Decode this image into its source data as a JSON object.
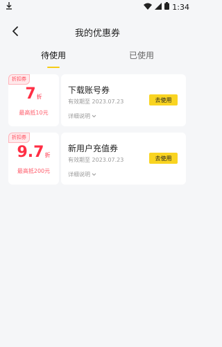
{
  "status_bar": {
    "time": "1:34",
    "icons": [
      "download-icon",
      "wifi-icon",
      "signal-icon",
      "battery-icon"
    ]
  },
  "header": {
    "title": "我的优惠券",
    "back_icon": "chevron-left-icon"
  },
  "tabs": [
    {
      "label": "待使用",
      "active": true
    },
    {
      "label": "已使用",
      "active": false
    }
  ],
  "coupons": [
    {
      "tag": "折扣券",
      "discount_value": "7",
      "discount_unit": "折",
      "max_off": "最高抵10元",
      "title": "下载账号券",
      "expire": "有效期至 2023.07.23",
      "detail_label": "详细说明",
      "use_label": "去使用"
    },
    {
      "tag": "折扣券",
      "discount_value": "9.7",
      "discount_unit": "折",
      "max_off": "最高抵200元",
      "title": "新用户充值券",
      "expire": "有效期至 2023.07.23",
      "detail_label": "详细说明",
      "use_label": "去使用"
    }
  ],
  "colors": {
    "accent": "#F9D421",
    "discount_red": "#FF2E44",
    "background": "#F5F6F8"
  }
}
